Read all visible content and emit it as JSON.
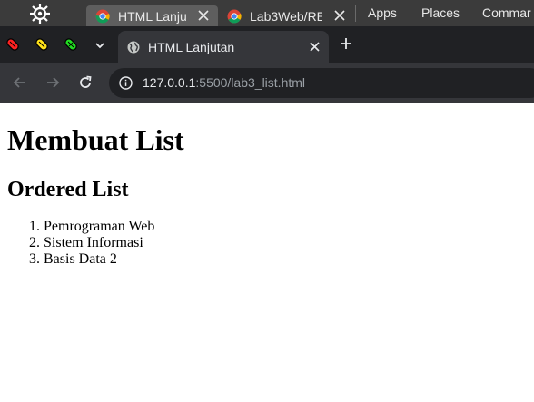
{
  "os_panel": {
    "tabs": [
      {
        "label": "HTML Lanju",
        "icon": "chrome-icon"
      },
      {
        "label": "Lab3Web/RE",
        "icon": "chrome-icon"
      }
    ],
    "menus": [
      "Apps",
      "Places",
      "Commar"
    ]
  },
  "browser": {
    "active_tab": {
      "title": "HTML Lanjutan",
      "icon": "globe-icon"
    },
    "url": {
      "host": "127.0.0.1",
      "rest": ":5500/lab3_list.html"
    }
  },
  "page": {
    "heading": "Membuat List",
    "subheading": "Ordered List",
    "items": [
      "Pemrograman Web",
      "Sistem Informasi",
      "Basis Data 2"
    ]
  }
}
